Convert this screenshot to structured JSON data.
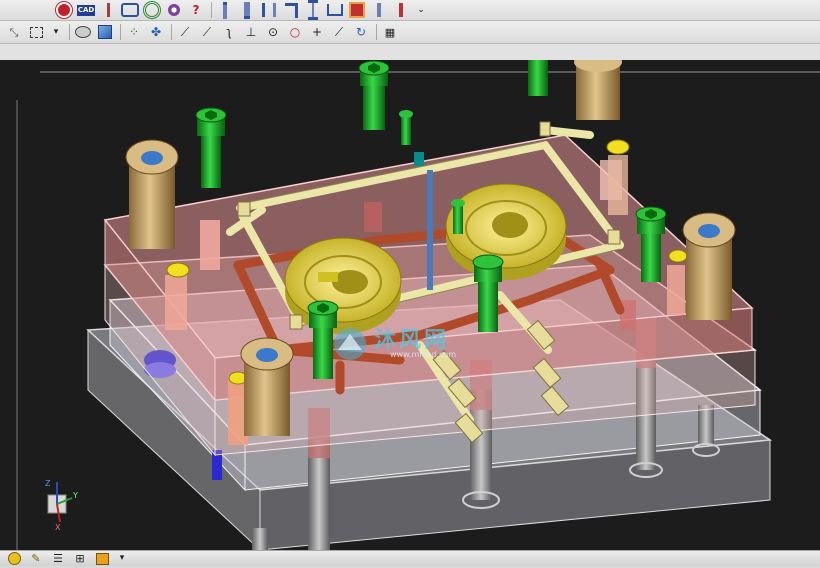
{
  "toolbar_top": {
    "buttons": [
      {
        "icon": "red-disc-icon",
        "color": "#c0202a"
      },
      {
        "icon": "cad-icon",
        "label": "CAD",
        "color": "#1f3e9a"
      },
      {
        "icon": "ejector-pin-icon",
        "color": "#a04040"
      },
      {
        "icon": "mold-plate-icon",
        "color": "#3050a0"
      },
      {
        "icon": "target-icon",
        "color": "#2a8a3a"
      },
      {
        "icon": "gear-disc-icon",
        "color": "#8040a0"
      },
      {
        "icon": "help-query-icon",
        "color": "#c02020"
      },
      {
        "icon": "pin-icon",
        "color": "#4060a0"
      },
      {
        "icon": "bolt-icon",
        "color": "#4060a0"
      },
      {
        "icon": "slider-icon",
        "color": "#4060a0"
      },
      {
        "icon": "step-icon",
        "color": "#4060a0"
      },
      {
        "icon": "lifter-icon",
        "color": "#4060a0"
      },
      {
        "icon": "clamp-icon",
        "color": "#4060a0"
      },
      {
        "icon": "insert-icon",
        "color": "#c03030"
      },
      {
        "icon": "rod-icon",
        "color": "#4060a0"
      },
      {
        "icon": "spring-icon",
        "color": "#c03030"
      }
    ],
    "overflow": "⌄"
  },
  "toolbar_second": {
    "buttons": [
      {
        "icon": "select-arrow-icon"
      },
      {
        "icon": "box-select-icon"
      },
      {
        "icon": "dropdown-icon",
        "label": "▾"
      },
      {
        "icon": "view-shaded-icon"
      },
      {
        "icon": "cube-view-icon"
      },
      {
        "icon": "network-icon"
      },
      {
        "icon": "node-icon"
      },
      {
        "icon": "line-icon"
      },
      {
        "icon": "trim-line-icon"
      },
      {
        "icon": "curve-icon"
      },
      {
        "icon": "normal-icon"
      },
      {
        "icon": "circle-center-icon"
      },
      {
        "icon": "circle-icon"
      },
      {
        "icon": "cross-icon"
      },
      {
        "icon": "tangent-icon"
      },
      {
        "icon": "rotate-view-icon"
      },
      {
        "icon": "grid-icon"
      }
    ]
  },
  "viewport": {
    "background": "#1c1c1c",
    "axes": {
      "x": "X",
      "y": "Y",
      "z": "Z"
    },
    "watermark": {
      "text": "沐风网",
      "url": "www.mfcad.com"
    }
  },
  "statusbar": {
    "buttons": [
      {
        "icon": "compass-icon"
      },
      {
        "icon": "pen-icon"
      },
      {
        "icon": "layer-icon"
      },
      {
        "icon": "hierarchy-icon"
      },
      {
        "icon": "paint-bucket-icon"
      },
      {
        "icon": "dropdown-icon",
        "label": "▾"
      }
    ]
  },
  "colors": {
    "plate_pink": "#e89898",
    "clear_plate": "#e8e8f0",
    "bushing": "#c8a870",
    "bolt_green": "#1fae2a",
    "cooling": "#e8e2a0",
    "runner": "#c05030",
    "part_yellow": "#e4d84a"
  }
}
